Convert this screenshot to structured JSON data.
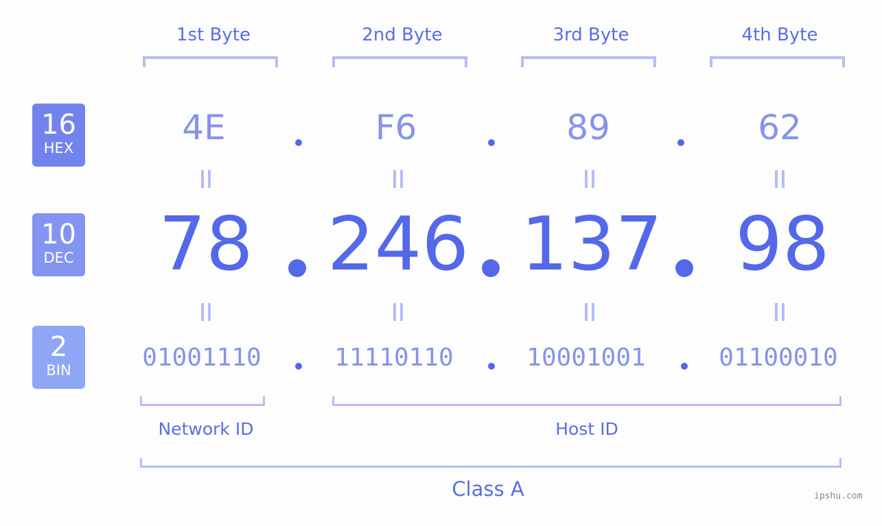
{
  "headers": [
    "1st Byte",
    "2nd Byte",
    "3rd Byte",
    "4th Byte"
  ],
  "badges": {
    "hex": {
      "num": "16",
      "label": "HEX",
      "color": "#7383ed"
    },
    "dec": {
      "num": "10",
      "label": "DEC",
      "color": "#8494f1"
    },
    "bin": {
      "num": "2",
      "label": "BIN",
      "color": "#8fa6f7"
    }
  },
  "hex": [
    "4E",
    "F6",
    "89",
    "62"
  ],
  "dec": [
    "78",
    "246",
    "137",
    "98"
  ],
  "bin": [
    "01001110",
    "11110110",
    "10001001",
    "01100010"
  ],
  "labels": {
    "network": "Network ID",
    "host": "Host ID",
    "class": "Class A"
  },
  "watermark": "ipshu.com",
  "colors": {
    "accent": "#5468ea",
    "light": "#8593eb",
    "bracket": "#b4bdf6"
  }
}
